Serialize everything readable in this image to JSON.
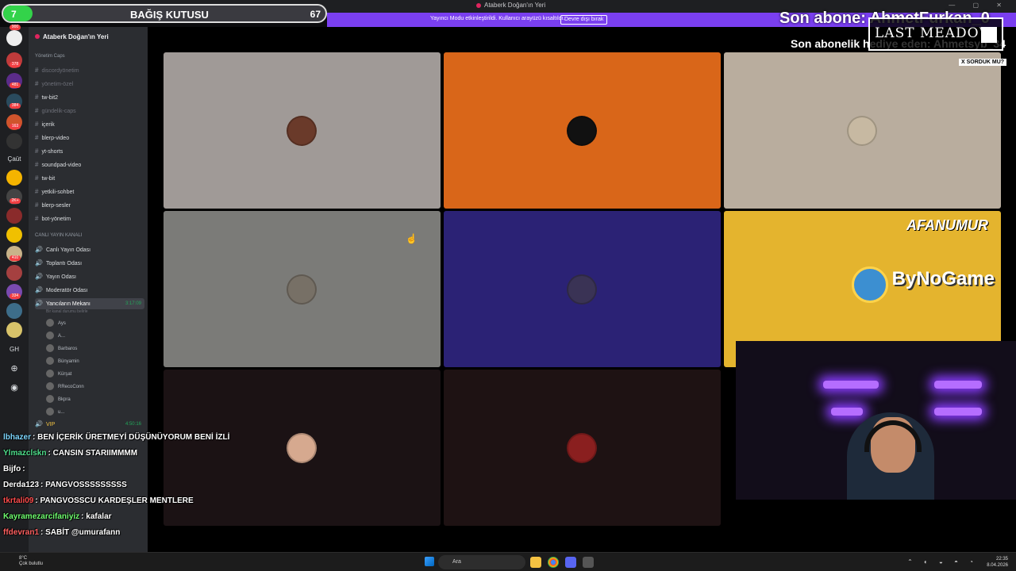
{
  "window": {
    "title": "Ataberk Doğan'ın Yeri"
  },
  "streamer_banner": {
    "message": "Yayıncı Modu etkinleştirildi. Kullanıcı arayüzü kısaltıldı.",
    "disable_label": "Devre dışı bırak"
  },
  "donation": {
    "title": "BAĞIŞ KUTUSU",
    "start": "7",
    "count": "67",
    "progress": 0.09
  },
  "overlay": {
    "last_sub": "Son abone: AhmetFurkan_0",
    "last_gift": "Son abonelik hediye eden: Ahmetsyb_34",
    "last_meadow": "LAST MEADOW",
    "sorduk": "X SORDUK MU?"
  },
  "rail": {
    "badges": [
      "900",
      "378",
      "481",
      "384",
      "163",
      "2K+",
      "410",
      "334"
    ],
    "labels": {
      "cault": "Çaüt",
      "gh": "GH"
    },
    "icons": [
      "home-icon",
      "add-server-icon",
      "discover-icon"
    ]
  },
  "guild": {
    "name": "Ataberk Doğan'ın Yeri"
  },
  "channels": [
    {
      "label": "Yönetim Caps",
      "type": "cat"
    },
    {
      "label": "discordyönetim",
      "type": "muted"
    },
    {
      "label": "yönetim-özel",
      "type": "muted"
    },
    {
      "label": "tw-bit2",
      "type": "text"
    },
    {
      "label": "gündelik-caps",
      "type": "muted"
    },
    {
      "label": "içerik",
      "type": "text"
    },
    {
      "label": "blerp-video",
      "type": "text"
    },
    {
      "label": "yt-shorts",
      "type": "text"
    },
    {
      "label": "soundpad-video",
      "type": "text"
    },
    {
      "label": "tw-bit",
      "type": "text"
    },
    {
      "label": "yetkili-sohbet",
      "type": "text"
    },
    {
      "label": "blerp-sesler",
      "type": "text"
    },
    {
      "label": "bot-yönetim",
      "type": "text"
    },
    {
      "label": "CANLI YAYIN KANALI",
      "type": "cat"
    },
    {
      "label": "Canlı Yayın Odası",
      "type": "voice"
    },
    {
      "label": "Toplantı Odası",
      "type": "voice"
    },
    {
      "label": "Yayın Odası",
      "type": "voice"
    },
    {
      "label": "Moderatör Odası",
      "type": "voice"
    },
    {
      "label": "Yancıların Mekanı",
      "type": "active",
      "time": "3:17:09",
      "sub": "Bir kanal durumu belirle"
    }
  ],
  "members": [
    "Ays",
    "A...",
    "Barbaros",
    "Bünyamin",
    "Kürşat",
    "RRecoConn",
    "Bkpra",
    "u..."
  ],
  "vip": {
    "label": "VIP",
    "time": "4:50:16"
  },
  "tiles": [
    {
      "color": "#a09a97",
      "avatar": "#6a3a2a"
    },
    {
      "color": "#d96619",
      "avatar": "#111111"
    },
    {
      "color": "#b9ad9e",
      "avatar": "#c7b9a2"
    },
    {
      "color": "#7b7b78",
      "avatar": "#777066"
    },
    {
      "color": "#2b2275",
      "avatar": "#3a3355"
    },
    {
      "color": "#e4b42e",
      "avatar": null
    },
    {
      "color": "#1b1214",
      "avatar": "#d6a98f"
    },
    {
      "color": "#1e1213",
      "avatar": "#8a1f1f"
    }
  ],
  "sponsor": {
    "afanumur": "AFANUMUR",
    "bynogame": "ByNoGame"
  },
  "chat": [
    {
      "user": "lbhazer",
      "color": "#7ed7ff",
      "text": ": BEN İÇERİK ÜRETMEYİ DÜŞÜNÜYORUM BENİ İZLİ"
    },
    {
      "user": "Ylmazclskn",
      "color": "#4fe08c",
      "text": ": CANSIN STARIIMMMM"
    },
    {
      "user": "Bijfo",
      "color": "#ffffff",
      "text": ":"
    },
    {
      "user": "Derda123",
      "color": "#ffffff",
      "text": ": PANGVOSSSSSSSSS"
    },
    {
      "user": "tkrtali09",
      "color": "#ff4d4d",
      "text": ": PANGVOSSCU KARDEŞLER MENTLERE"
    },
    {
      "user": "Kayramezarcifaniyiz",
      "color": "#6fff6f",
      "text": ": kafalar"
    },
    {
      "user": "ffdevran1",
      "color": "#ff6060",
      "text": ": SABİT @umurafann"
    }
  ],
  "taskbar": {
    "weather_temp": "8°C",
    "weather_desc": "Çok bulutlu",
    "search": "Ara",
    "time": "22:35",
    "date": "8.04.2026"
  }
}
